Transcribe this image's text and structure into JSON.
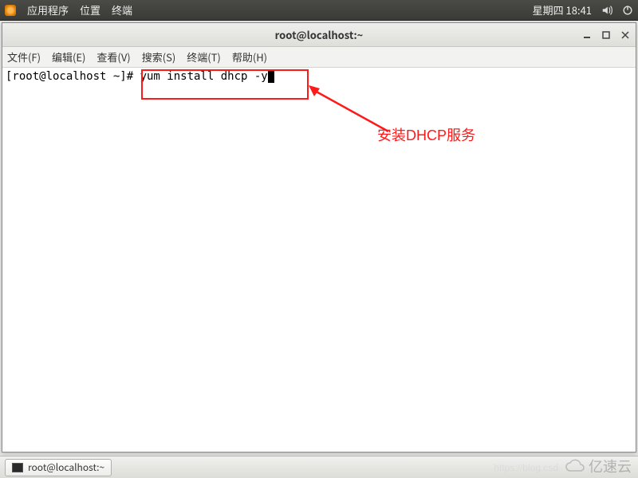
{
  "top_panel": {
    "apps": "应用程序",
    "places": "位置",
    "terminal": "终端",
    "day_time": "星期四 18:41"
  },
  "window": {
    "title": "root@localhost:~",
    "menus": {
      "file": "文件(F)",
      "edit": "编辑(E)",
      "view": "查看(V)",
      "search": "搜索(S)",
      "terminal": "终端(T)",
      "help": "帮助(H)"
    },
    "prompt": "[root@localhost ~]# ",
    "command": "yum install dhcp -y"
  },
  "annotation": {
    "label": "安装DHCP服务"
  },
  "taskbar": {
    "item": "root@localhost:~"
  },
  "watermark": {
    "text": "亿速云",
    "blog": "https://blog.csd"
  }
}
